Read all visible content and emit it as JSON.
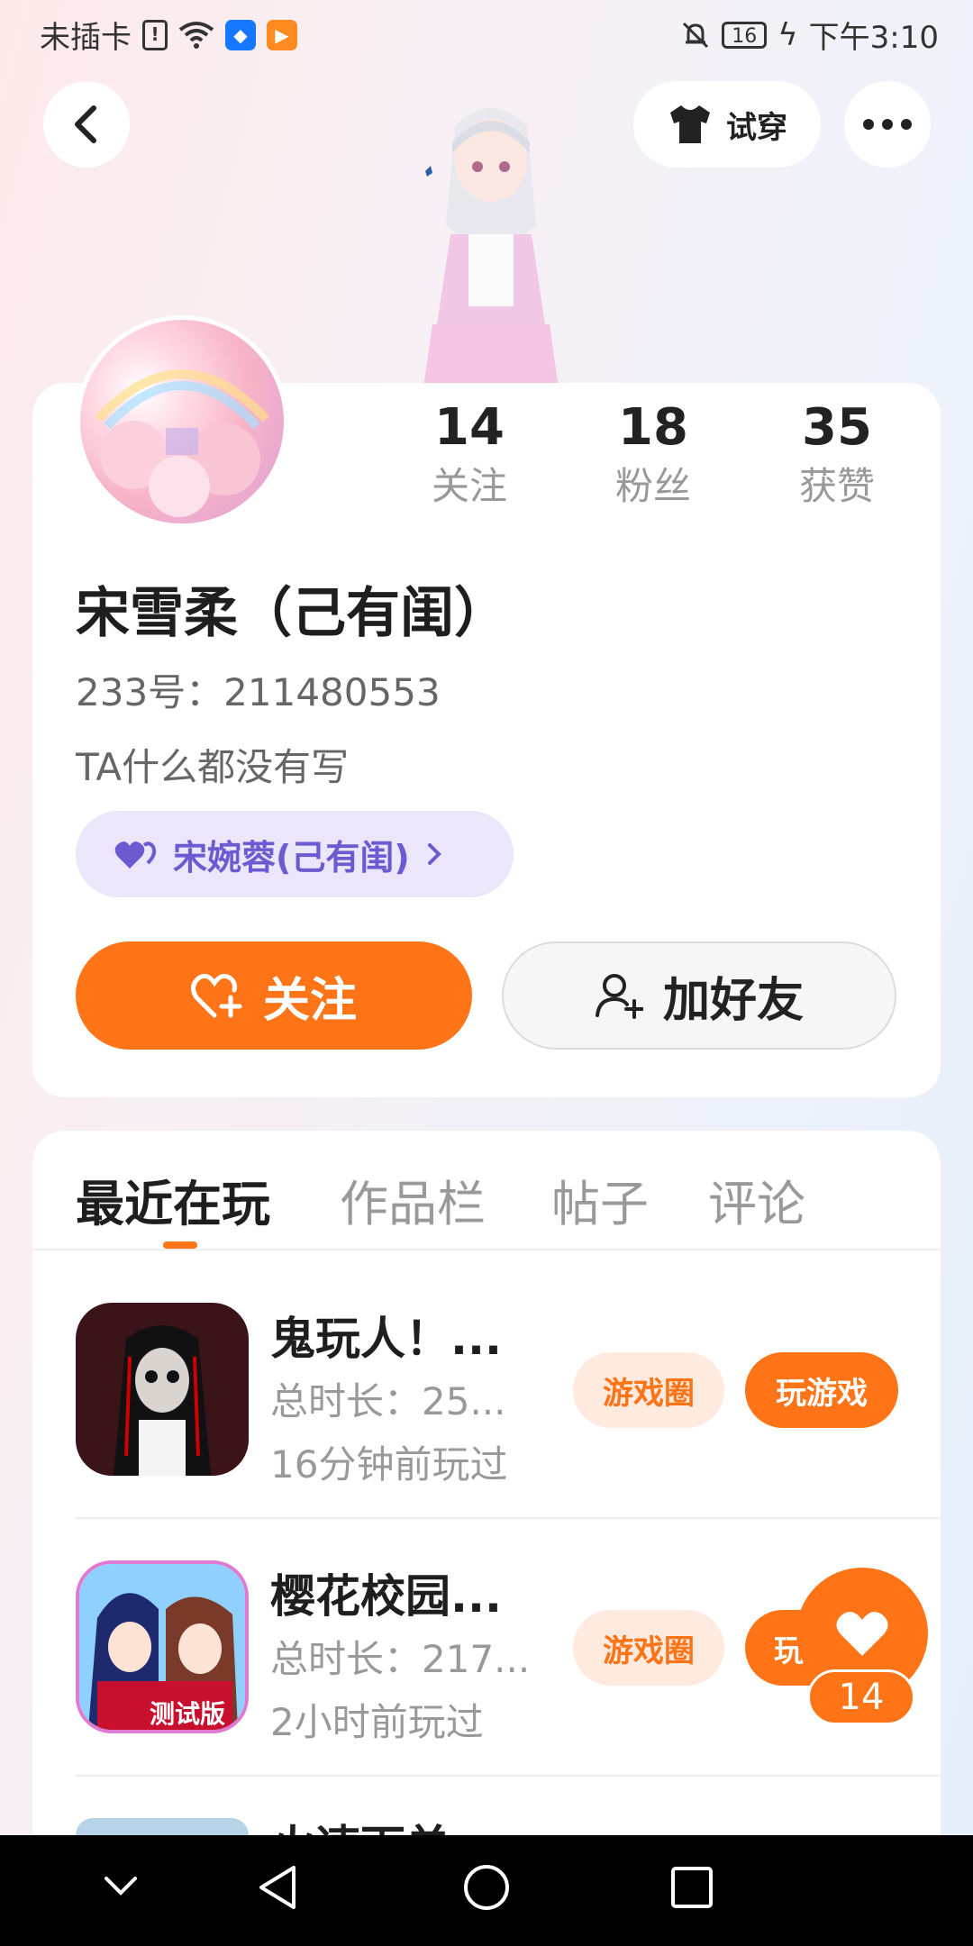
{
  "status_bar": {
    "carrier": "未插卡",
    "battery": "16",
    "time": "下午3:10"
  },
  "header": {
    "try_on_label": "试穿"
  },
  "profile": {
    "stats": [
      {
        "value": "14",
        "label": "关注"
      },
      {
        "value": "18",
        "label": "粉丝"
      },
      {
        "value": "35",
        "label": "获赞"
      }
    ],
    "name": "宋雪柔（己有闺）",
    "uid": "233号：211480553",
    "bio": "TA什么都没有写",
    "partner_label": "宋婉蓉(己有闺)",
    "follow_label": "关注",
    "add_friend_label": "加好友"
  },
  "tabs": [
    "最近在玩",
    "作品栏",
    "帖子",
    "评论"
  ],
  "games": [
    {
      "title": "鬼玩人！...",
      "duration": "总时长：25...",
      "last_played": "16分钟前玩过",
      "circle_label": "游戏圈",
      "play_label": "玩游戏"
    },
    {
      "title": "樱花校园...",
      "duration": "总时长：217...",
      "last_played": "2小时前玩过",
      "circle_label": "游戏圈",
      "play_label": "玩",
      "badge": "测试版"
    },
    {
      "title": "火速下单"
    }
  ],
  "like_count": "14",
  "colors": {
    "accent": "#ff7417",
    "partner_bg": "#ebe6fa",
    "partner_text": "#6c5bd0",
    "circle_pill_bg": "#ffeadf"
  }
}
